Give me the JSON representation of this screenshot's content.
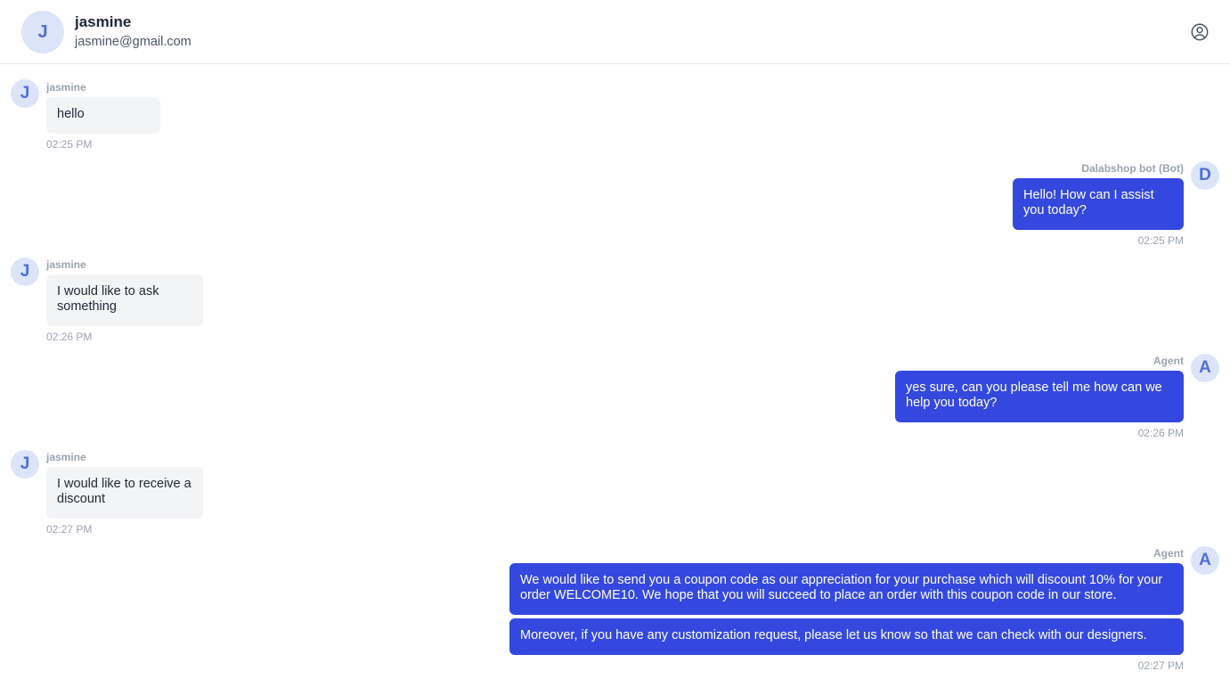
{
  "header": {
    "avatar_initial": "J",
    "name": "jasmine",
    "email": "jasmine@gmail.com",
    "profile_icon": "user-circle-icon"
  },
  "messages": [
    {
      "direction": "in",
      "sender": "jasmine",
      "initial": "J",
      "text": "hello",
      "time": "02:25 PM"
    },
    {
      "direction": "out",
      "sender": "Dalabshop bot (Bot)",
      "initial": "D",
      "text": "Hello! How can I assist you today?",
      "time": "02:25 PM"
    },
    {
      "direction": "in",
      "sender": "jasmine",
      "initial": "J",
      "text": "I would like to ask something",
      "time": "02:26 PM"
    },
    {
      "direction": "out",
      "sender": "Agent",
      "initial": "A",
      "text": "yes sure, can you please tell me how can we help you today?",
      "time": "02:26 PM"
    },
    {
      "direction": "in",
      "sender": "jasmine",
      "initial": "J",
      "text": "I would like to receive a discount",
      "time": "02:27 PM"
    },
    {
      "direction": "out",
      "sender": "Agent",
      "initial": "A",
      "text": "We would like to send you a coupon code as our appreciation for your purchase which will discount 10% for your order WELCOME10. We hope that you will succeed to place an order with this coupon code in our store.",
      "time": ""
    },
    {
      "direction": "out",
      "sender": "",
      "initial": "",
      "text": "Moreover, if you have any customization request, please let us know so that we can check with our designers.",
      "time": "02:27 PM"
    }
  ],
  "colors": {
    "outgoing_bubble": "#3448e0",
    "incoming_bubble": "#f3f4f6",
    "avatar_bg": "#dbe4f8",
    "avatar_text": "#4f6fd8"
  }
}
